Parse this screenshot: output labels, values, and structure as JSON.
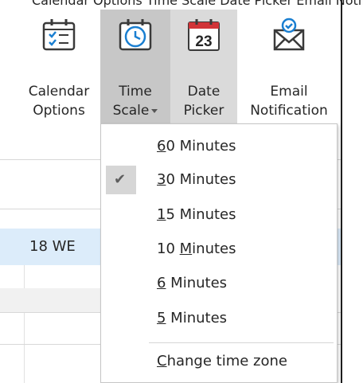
{
  "top_sliver_text": "Calendar Options Time Scale Date Picker Email Notification",
  "ribbon": {
    "buttons": [
      {
        "line1": "Calendar",
        "line2": "Options",
        "icon": "calendar-options-icon"
      },
      {
        "line1": "Time",
        "line2": "Scale",
        "icon": "clock-icon",
        "has_dropdown": true
      },
      {
        "line1": "Date",
        "line2": "Picker",
        "icon": "date-picker-icon",
        "icon_text": "23"
      },
      {
        "line1": "Email",
        "line2": "Notification",
        "icon": "email-notification-icon"
      }
    ]
  },
  "calendar": {
    "day_label": "18 WE"
  },
  "menu": {
    "items": [
      {
        "pre": "",
        "key": "6",
        "post": "0 Minutes",
        "checked": false
      },
      {
        "pre": "",
        "key": "3",
        "post": "0 Minutes",
        "checked": true
      },
      {
        "pre": "",
        "key": "1",
        "post": "5 Minutes",
        "checked": false
      },
      {
        "pre": "10 ",
        "key": "M",
        "post": "inutes",
        "checked": false
      },
      {
        "pre": "",
        "key": "6",
        "post": " Minutes",
        "checked": false
      },
      {
        "pre": "",
        "key": "5",
        "post": " Minutes",
        "checked": false
      }
    ],
    "change_time_zone": {
      "pre": "",
      "key": "C",
      "post": "hange time zone"
    }
  },
  "colors": {
    "pressed_button": "#c7c7c7",
    "hover_button": "#dadada",
    "selected_day_row": "#dcecfa",
    "icon_blue": "#1a7fd1",
    "date_red": "#d13438"
  }
}
